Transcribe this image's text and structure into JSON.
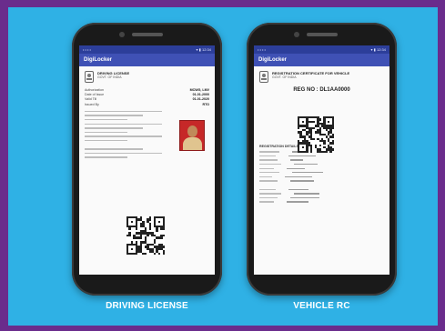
{
  "captions": {
    "left": "DRIVING LICENSE",
    "right": "VEHICLE RC"
  },
  "left_phone": {
    "status_left": "• • • •",
    "status_right": "▾ ▮ 12:34",
    "app_title": "DigiLocker",
    "doc_title": "DRIVING LICENSE",
    "issuer": "GOVT. OF INDIA",
    "fields": [
      {
        "k": "Authorization",
        "v": "MCWG, LMV"
      },
      {
        "k": "Date of Issue",
        "v": "01-01-2000"
      },
      {
        "k": "Valid Till",
        "v": "01-01-2020"
      },
      {
        "k": "Issued By",
        "v": "RTO"
      }
    ]
  },
  "right_phone": {
    "status_left": "• • • •",
    "status_right": "▾ ▮ 12:34",
    "app_title": "DigiLocker",
    "doc_title": "REGISTRATION CERTIFICATE FOR VEHICLE",
    "issuer": "GOVT. OF INDIA",
    "reg_no": "REG NO : DL1AA0000",
    "section_title": "REGISTRATION DETAILS"
  },
  "colors": {
    "border": "#6a2c8c",
    "background": "#2fb1e5",
    "appbar": "#3f51b5"
  }
}
